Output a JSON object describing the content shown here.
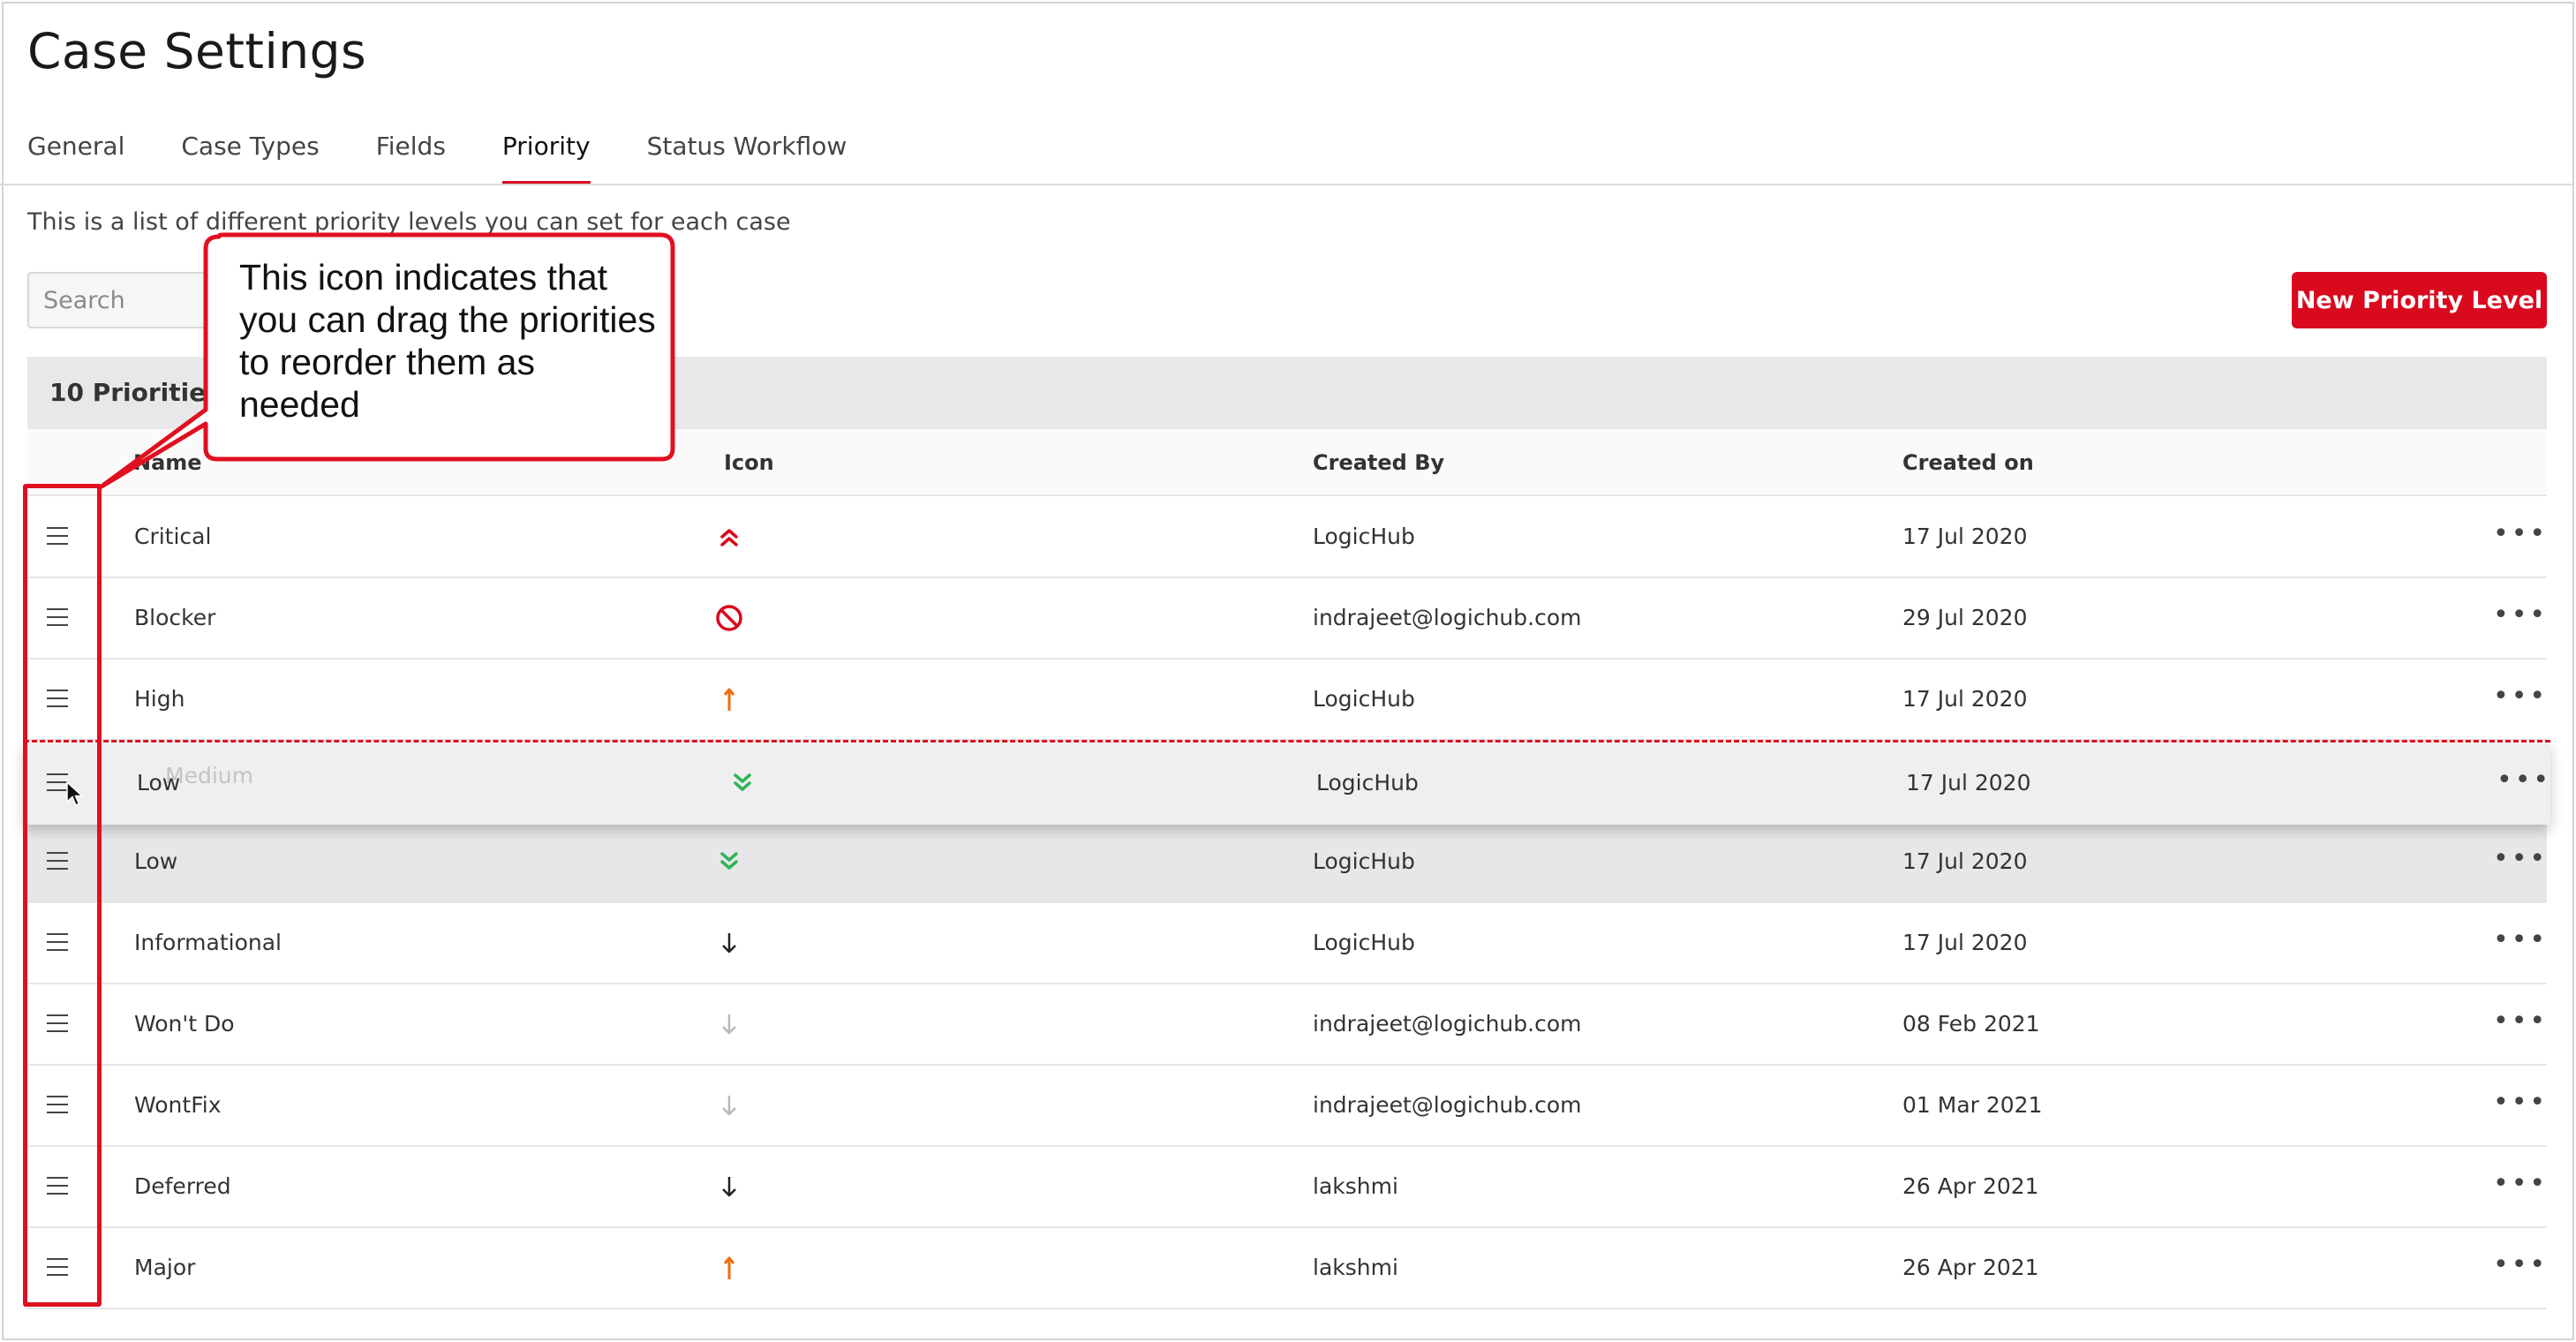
{
  "page": {
    "title": "Case Settings"
  },
  "tabs": [
    {
      "label": "General",
      "active": false
    },
    {
      "label": "Case Types",
      "active": false
    },
    {
      "label": "Fields",
      "active": false
    },
    {
      "label": "Priority",
      "active": true
    },
    {
      "label": "Status Workflow",
      "active": false
    }
  ],
  "description": "This is a list of different priority levels you can set for each case",
  "search": {
    "placeholder": "Search",
    "value": ""
  },
  "new_button": {
    "label": "New Priority Level"
  },
  "count_label": "10 Priorities",
  "columns": {
    "name": "Name",
    "icon": "Icon",
    "created_by": "Created By",
    "created_on": "Created on"
  },
  "rows": [
    {
      "name": "Critical",
      "icon": "double-chevron-up-icon",
      "icon_color": "#d9091e",
      "created_by": "LogicHub",
      "created_on": "17 Jul 2020"
    },
    {
      "name": "Blocker",
      "icon": "blocked-icon",
      "icon_color": "#d9091e",
      "created_by": "indrajeet@logichub.com",
      "created_on": "29 Jul 2020"
    },
    {
      "name": "High",
      "icon": "arrow-up-icon",
      "icon_color": "#f06a0f",
      "created_by": "LogicHub",
      "created_on": "17 Jul 2020"
    },
    {
      "name": "Low",
      "icon": "double-chevron-down-icon",
      "icon_color": "#2fb457",
      "created_by": "LogicHub",
      "created_on": "17 Jul 2020",
      "placeholder": true
    },
    {
      "name": "Informational",
      "icon": "arrow-down-icon",
      "icon_color": "#222222",
      "created_by": "LogicHub",
      "created_on": "17 Jul 2020"
    },
    {
      "name": "Won't Do",
      "icon": "arrow-down-icon",
      "icon_color": "#b8b8b8",
      "created_by": "indrajeet@logichub.com",
      "created_on": "08 Feb 2021"
    },
    {
      "name": "WontFix",
      "icon": "arrow-down-icon",
      "icon_color": "#b8b8b8",
      "created_by": "indrajeet@logichub.com",
      "created_on": "01 Mar 2021"
    },
    {
      "name": "Deferred",
      "icon": "arrow-down-icon",
      "icon_color": "#222222",
      "created_by": "lakshmi",
      "created_on": "26 Apr 2021"
    },
    {
      "name": "Major",
      "icon": "arrow-up-icon",
      "icon_color": "#f06a0f",
      "created_by": "lakshmi",
      "created_on": "26 Apr 2021"
    }
  ],
  "dragging_row": {
    "name": "Low",
    "behind_text": "Medium",
    "icon": "double-chevron-down-icon",
    "icon_color": "#2fb457",
    "created_by": "LogicHub",
    "created_on": "17 Jul 2020"
  },
  "callout": {
    "text": "This icon indicates that you can drag the priorities to reorder them as needed",
    "color": "#e01020"
  },
  "colors": {
    "accent": "#d9091e"
  }
}
